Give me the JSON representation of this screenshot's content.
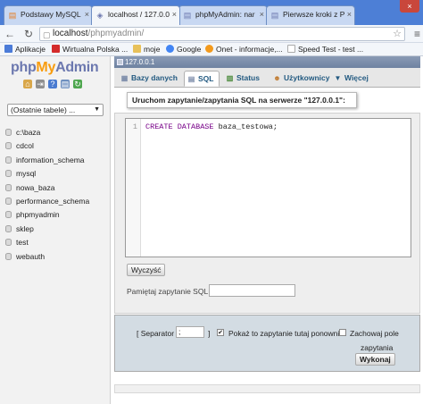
{
  "browser": {
    "tabs": [
      {
        "label": "Podstawy MySQL",
        "active": false
      },
      {
        "label": "localhost / 127.0.0",
        "active": true
      },
      {
        "label": "phpMyAdmin: nar",
        "active": false
      },
      {
        "label": "Pierwsze kroki z P",
        "active": false
      }
    ],
    "url_host": "localhost",
    "url_path": "/phpmyadmin/",
    "close_glyph": "×",
    "bookmarks": [
      {
        "label": "Aplikacje",
        "icon": "apps-grid-icon",
        "color": "#4b7bd8"
      },
      {
        "label": "Wirtualna Polska ...",
        "icon": "wp-icon",
        "color": "#d42b2b"
      },
      {
        "label": "moje",
        "icon": "folder-icon",
        "color": "#e8c15a"
      },
      {
        "label": "Google",
        "icon": "google-icon",
        "color": "#4285f4"
      },
      {
        "label": "Onet - informacje,...",
        "icon": "onet-icon",
        "color": "#f39a1d"
      },
      {
        "label": "Speed Test - test ...",
        "icon": "page-icon",
        "color": "#d0d0d0"
      }
    ]
  },
  "sidebar": {
    "logo": {
      "php": "php",
      "my": "My",
      "admin": "Admin"
    },
    "recent_tables": "(Ostatnie tabele) ...",
    "databases": [
      "c:\\baza",
      "cdcol",
      "information_schema",
      "mysql",
      "nowa_baza",
      "performance_schema",
      "phpmyadmin",
      "sklep",
      "test",
      "webauth"
    ]
  },
  "main": {
    "server": "127.0.0.1",
    "tabs": [
      {
        "label": "Bazy danych",
        "icon": "database-icon"
      },
      {
        "label": "SQL",
        "icon": "sql-icon"
      },
      {
        "label": "Status",
        "icon": "status-icon"
      },
      {
        "label": "Użytkownicy",
        "icon": "users-icon"
      },
      {
        "label": "Więcej",
        "icon": "more-icon"
      }
    ],
    "query_title": "Uruchom zapytanie/zapytania SQL na serwerze \"127.0.0.1\":",
    "editor": {
      "line_number": "1",
      "keyword": "CREATE DATABASE",
      "rest": " baza_testowa;"
    },
    "clear_button": "Wyczyść",
    "bookmark_label": "Pamiętaj zapytanie SQL:",
    "bookmark_value": "",
    "separator_label": "[ Separator",
    "separator_value": ";",
    "separator_close": "]",
    "show_query_label": "Pokaż to zapytanie tutaj ponownie",
    "show_query_checked": true,
    "retain_box_label": "Zachowaj pole",
    "retain_box_label2": "zapytania",
    "retain_box_checked": false,
    "go_button": "Wykonaj"
  },
  "colors": {
    "chrome_blue": "#4d7fd6",
    "pma_link": "#235a81",
    "sql_keyword": "#770088"
  }
}
